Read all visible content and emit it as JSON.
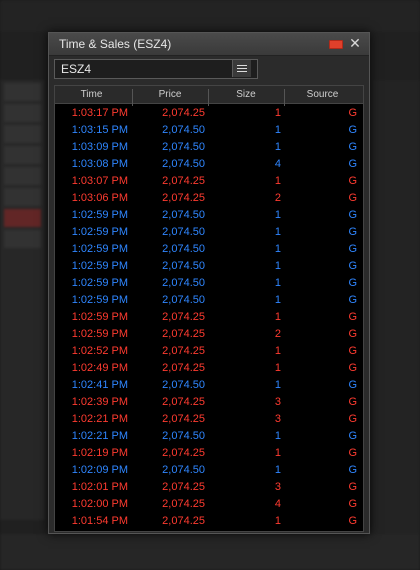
{
  "window": {
    "title": "Time & Sales (ESZ4)"
  },
  "symbol": {
    "value": "ESZ4"
  },
  "columns": [
    "Time",
    "Price",
    "Size",
    "Source"
  ],
  "colors": {
    "up": "#2f86ff",
    "down": "#ff3b30"
  },
  "rows": [
    {
      "time": "1:03:17 PM",
      "price": "2,074.25",
      "size": "1",
      "source": "G",
      "dir": "down"
    },
    {
      "time": "1:03:15 PM",
      "price": "2,074.50",
      "size": "1",
      "source": "G",
      "dir": "up"
    },
    {
      "time": "1:03:09 PM",
      "price": "2,074.50",
      "size": "1",
      "source": "G",
      "dir": "up"
    },
    {
      "time": "1:03:08 PM",
      "price": "2,074.50",
      "size": "4",
      "source": "G",
      "dir": "up"
    },
    {
      "time": "1:03:07 PM",
      "price": "2,074.25",
      "size": "1",
      "source": "G",
      "dir": "down"
    },
    {
      "time": "1:03:06 PM",
      "price": "2,074.25",
      "size": "2",
      "source": "G",
      "dir": "down"
    },
    {
      "time": "1:02:59 PM",
      "price": "2,074.50",
      "size": "1",
      "source": "G",
      "dir": "up"
    },
    {
      "time": "1:02:59 PM",
      "price": "2,074.50",
      "size": "1",
      "source": "G",
      "dir": "up"
    },
    {
      "time": "1:02:59 PM",
      "price": "2,074.50",
      "size": "1",
      "source": "G",
      "dir": "up"
    },
    {
      "time": "1:02:59 PM",
      "price": "2,074.50",
      "size": "1",
      "source": "G",
      "dir": "up"
    },
    {
      "time": "1:02:59 PM",
      "price": "2,074.50",
      "size": "1",
      "source": "G",
      "dir": "up"
    },
    {
      "time": "1:02:59 PM",
      "price": "2,074.50",
      "size": "1",
      "source": "G",
      "dir": "up"
    },
    {
      "time": "1:02:59 PM",
      "price": "2,074.25",
      "size": "1",
      "source": "G",
      "dir": "down"
    },
    {
      "time": "1:02:59 PM",
      "price": "2,074.25",
      "size": "2",
      "source": "G",
      "dir": "down"
    },
    {
      "time": "1:02:52 PM",
      "price": "2,074.25",
      "size": "1",
      "source": "G",
      "dir": "down"
    },
    {
      "time": "1:02:49 PM",
      "price": "2,074.25",
      "size": "1",
      "source": "G",
      "dir": "down"
    },
    {
      "time": "1:02:41 PM",
      "price": "2,074.50",
      "size": "1",
      "source": "G",
      "dir": "up"
    },
    {
      "time": "1:02:39 PM",
      "price": "2,074.25",
      "size": "3",
      "source": "G",
      "dir": "down"
    },
    {
      "time": "1:02:21 PM",
      "price": "2,074.25",
      "size": "3",
      "source": "G",
      "dir": "down"
    },
    {
      "time": "1:02:21 PM",
      "price": "2,074.50",
      "size": "1",
      "source": "G",
      "dir": "up"
    },
    {
      "time": "1:02:19 PM",
      "price": "2,074.25",
      "size": "1",
      "source": "G",
      "dir": "down"
    },
    {
      "time": "1:02:09 PM",
      "price": "2,074.50",
      "size": "1",
      "source": "G",
      "dir": "up"
    },
    {
      "time": "1:02:01 PM",
      "price": "2,074.25",
      "size": "3",
      "source": "G",
      "dir": "down"
    },
    {
      "time": "1:02:00 PM",
      "price": "2,074.25",
      "size": "4",
      "source": "G",
      "dir": "down"
    },
    {
      "time": "1:01:54 PM",
      "price": "2,074.25",
      "size": "1",
      "source": "G",
      "dir": "down"
    }
  ]
}
